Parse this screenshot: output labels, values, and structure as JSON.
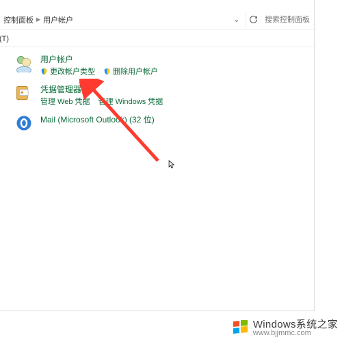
{
  "breadcrumb": {
    "seg1": "控制面板",
    "seg2": "用户帐户"
  },
  "nav": {
    "dropdown": "⌄",
    "refresh": "↻"
  },
  "search": {
    "placeholder": "搜索控制面板"
  },
  "toolbar": {
    "tools": "工具(T)"
  },
  "items": [
    {
      "title": "用户帐户",
      "subs": [
        {
          "shield": true,
          "label": "更改帐户类型"
        },
        {
          "shield": true,
          "label": "删除用户帐户"
        }
      ]
    },
    {
      "title": "凭据管理器",
      "subs": [
        {
          "shield": false,
          "label": "管理 Web 凭据"
        },
        {
          "shield": false,
          "label": "管理 Windows 凭据"
        }
      ]
    },
    {
      "title": "Mail (Microsoft Outlook) (32 位)",
      "subs": []
    }
  ],
  "watermark": {
    "brand": "Windows",
    "tag": "系统之家",
    "url": "www.bjjmmc.com"
  }
}
